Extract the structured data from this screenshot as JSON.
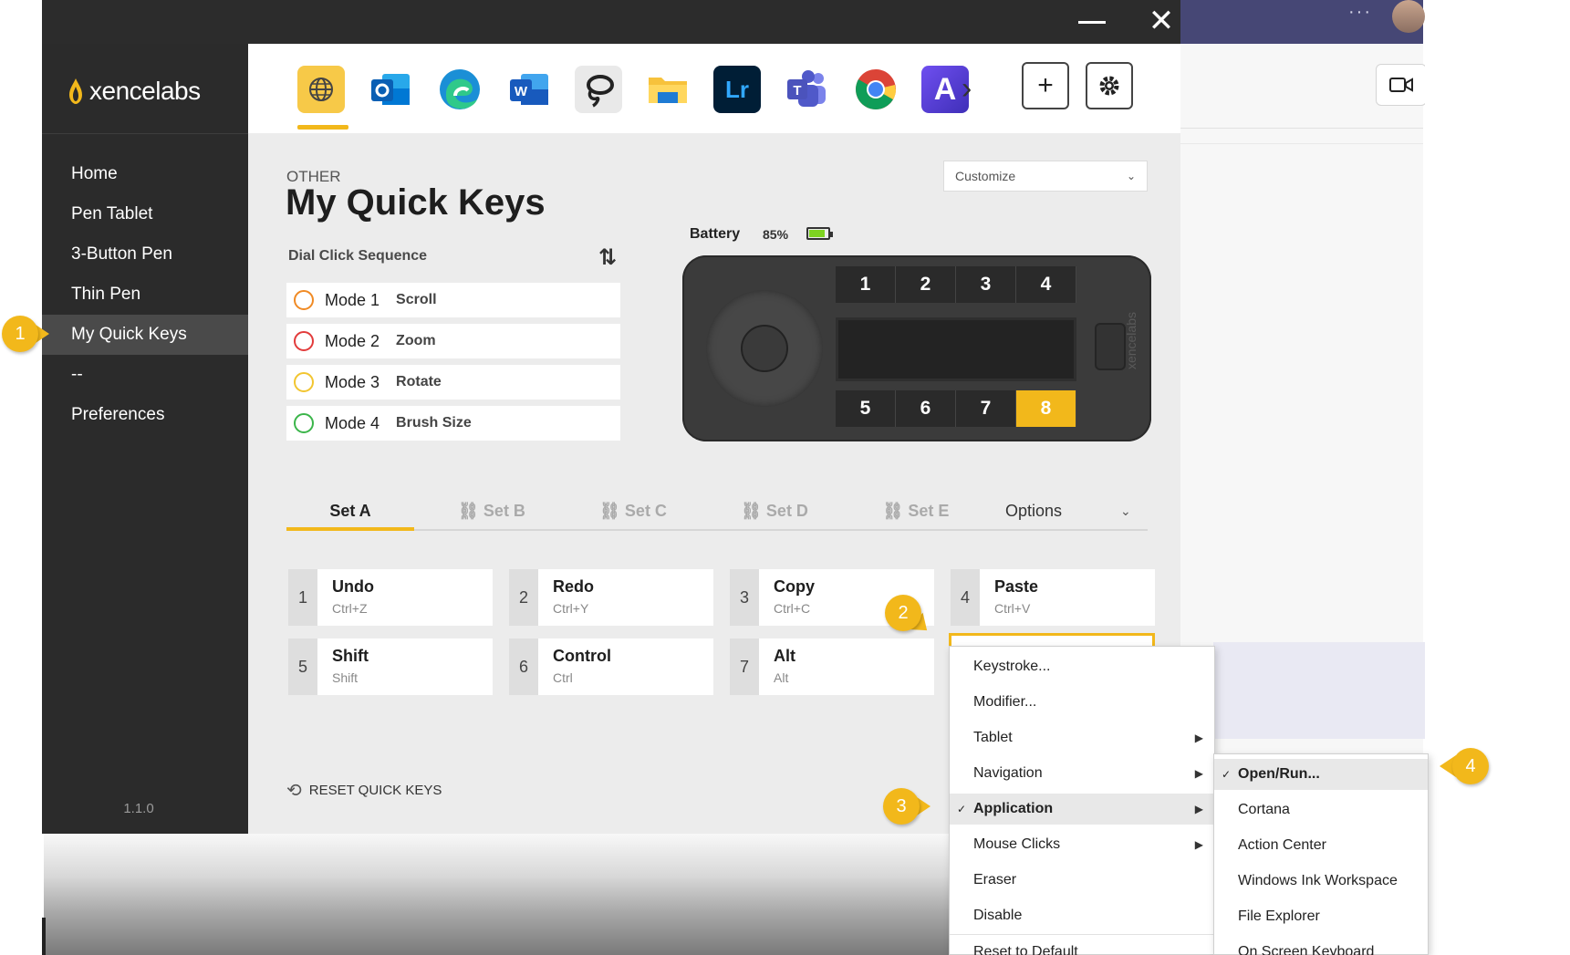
{
  "app": {
    "brand": "xencelabs",
    "version": "1.1.0",
    "accent": "#f2b81b"
  },
  "sidebar": {
    "items": [
      {
        "label": "Home"
      },
      {
        "label": "Pen Tablet"
      },
      {
        "label": "3-Button Pen"
      },
      {
        "label": "Thin Pen"
      },
      {
        "label": "My Quick Keys"
      },
      {
        "label": "--"
      },
      {
        "label": "Preferences"
      }
    ]
  },
  "app_bar": {
    "icons": [
      "globe-icon",
      "outlook-icon",
      "edge-icon",
      "word-icon",
      "lasso-icon",
      "file-explorer-icon",
      "lightroom-icon",
      "teams-icon",
      "chrome-icon",
      "font-app-icon"
    ],
    "more": "›",
    "add": "+",
    "settings": "⚙"
  },
  "page": {
    "eyebrow": "OTHER",
    "title": "My Quick Keys",
    "profile_select": "Customize"
  },
  "dial": {
    "label": "Dial Click Sequence",
    "modes": [
      {
        "name": "Mode 1",
        "action": "Scroll",
        "color": "#f08a24"
      },
      {
        "name": "Mode 2",
        "action": "Zoom",
        "color": "#e23b3b"
      },
      {
        "name": "Mode 3",
        "action": "Rotate",
        "color": "#f2c530"
      },
      {
        "name": "Mode 4",
        "action": "Brush Size",
        "color": "#3bb54a"
      }
    ]
  },
  "device": {
    "battery_label": "Battery",
    "battery_pct": "85%",
    "battery_level": 0.85,
    "top_keys": [
      "1",
      "2",
      "3",
      "4"
    ],
    "bottom_keys": [
      "5",
      "6",
      "7",
      "8"
    ],
    "selected_key": "8",
    "brand": "xencelabs"
  },
  "tabs": {
    "items": [
      {
        "label": "Set A"
      },
      {
        "label": "Set B"
      },
      {
        "label": "Set C"
      },
      {
        "label": "Set D"
      },
      {
        "label": "Set E"
      }
    ],
    "options": "Options"
  },
  "quick_keys": [
    {
      "num": "1",
      "name": "Undo",
      "shortcut": "Ctrl+Z"
    },
    {
      "num": "2",
      "name": "Redo",
      "shortcut": "Ctrl+Y"
    },
    {
      "num": "3",
      "name": "Copy",
      "shortcut": "Ctrl+C"
    },
    {
      "num": "4",
      "name": "Paste",
      "shortcut": "Ctrl+V"
    },
    {
      "num": "5",
      "name": "Shift",
      "shortcut": "Shift"
    },
    {
      "num": "6",
      "name": "Control",
      "shortcut": "Ctrl"
    },
    {
      "num": "7",
      "name": "Alt",
      "shortcut": "Alt"
    }
  ],
  "reset_label": "RESET QUICK KEYS",
  "context_menu": {
    "items": [
      {
        "label": "Keystroke..."
      },
      {
        "label": "Modifier..."
      },
      {
        "label": "Tablet"
      },
      {
        "label": "Navigation"
      },
      {
        "label": "Application"
      },
      {
        "label": "Mouse Clicks"
      },
      {
        "label": "Eraser"
      },
      {
        "label": "Disable"
      },
      {
        "label": "Reset to Default"
      }
    ]
  },
  "submenu": {
    "items": [
      {
        "label": "Open/Run..."
      },
      {
        "label": "Cortana"
      },
      {
        "label": "Action Center"
      },
      {
        "label": "Windows Ink Workspace"
      },
      {
        "label": "File Explorer"
      },
      {
        "label": "On Screen Keyboard"
      }
    ]
  },
  "callouts": [
    "1",
    "2",
    "3",
    "4"
  ]
}
